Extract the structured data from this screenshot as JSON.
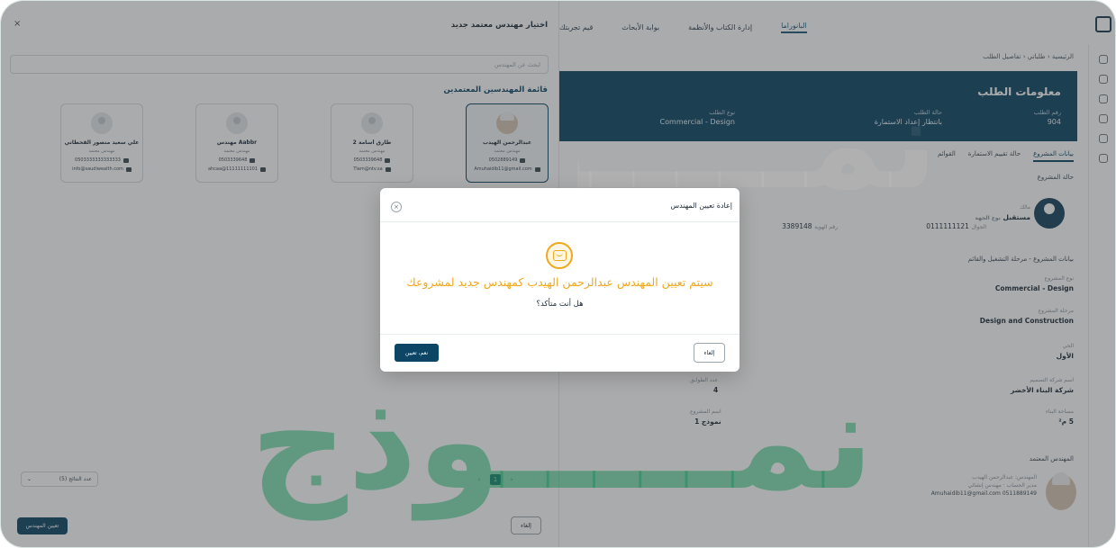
{
  "app": {
    "topnav": [
      "البانوراما",
      "إدارة الكتاب والأنظمة",
      "بوابة الأبحاث",
      "قيم تجربتك"
    ],
    "breadcrumb": "الرئيسية ‹ طلباتي ‹ تفاصيل الطلب",
    "banner": {
      "title": "معلومات الطلب",
      "cells": [
        {
          "label": "رقم الطلب",
          "value": "904"
        },
        {
          "label": "حالة الطلب",
          "value": "بانتظار إعداد الاستمارة"
        },
        {
          "label": "نوع الطلب",
          "value": "Commercial - Design"
        }
      ]
    },
    "tabs": [
      "بيانات المشروع",
      "حالة تقييم الاستمارة",
      "القوائم"
    ],
    "project_section": "حالة المشروع",
    "owner": {
      "name": "مالك",
      "type_label": "نوع الجهة",
      "type_value": "مستقبل",
      "phone_label": "الجوال",
      "phone": "0111111121",
      "id_label": "رقم الهوية",
      "id_value": "3389148"
    },
    "project_data_title": "بيانات المشروع - مرحلة التشغيل والقائم",
    "fields": [
      {
        "label": "نوع المشروع",
        "value": "Commercial - Design"
      },
      {
        "label": "مرحلة المشروع",
        "value": "Design and Construction"
      },
      {
        "label": "الحي",
        "value": "الأول"
      },
      {
        "label": "اسم شركة التصميم",
        "value": "شركة البناء الأخضر"
      },
      {
        "label": "مساحة البناء",
        "value": "5 م²"
      }
    ],
    "left_fields": [
      {
        "label": "عدد الطوابق",
        "value": "4"
      },
      {
        "label": "اسم المشروع",
        "value": "نموذج 1"
      }
    ],
    "engineer_section": "المهندس المعتمد",
    "engineer": {
      "title": "المهندس: عبدالرحمن الهيدب",
      "role": "مدير الحساب",
      "extra": "مهندس إنشائي",
      "email": "Amuhaidib11@gmail.com",
      "phone": "0511889149"
    }
  },
  "drawer": {
    "title": "اختيار مهندس معتمد جديد",
    "search_placeholder": "ابحث عن المهندس",
    "list_title": "قائمة المهندسين المعتمدين",
    "engineers": [
      {
        "name": "عبدالرحمن الهيدب",
        "role": "مهندس معتمد",
        "phone": "0502889149",
        "email": "Amuhaidib11@gmail.com",
        "has_photo": true,
        "selected": true
      },
      {
        "name": "طارق أسامة 2",
        "role": "مهندس معتمد",
        "phone": "0503339648",
        "email": "Tlam@ntv.sa",
        "has_photo": false,
        "selected": false
      },
      {
        "name": "مهندس Aabbr",
        "role": "مهندس معتمد",
        "phone": "0503339648",
        "email": "ahcaa@11111111101",
        "has_photo": false,
        "selected": false
      },
      {
        "name": "علي سعيد منصور القحطاني",
        "role": "مهندس معتمد",
        "phone": "0503333333333333",
        "email": "info@saudiwealth.com",
        "has_photo": false,
        "selected": false
      }
    ],
    "pager": {
      "prev": "‹",
      "current": "1",
      "next": "›"
    },
    "page_size_label": "عدد النتائج (5)",
    "page_size_arrow": "⌄",
    "assign_button": "تعيين المهندس",
    "cancel_button": "إلغاء"
  },
  "modal": {
    "title": "إعادة تعيين المهندس",
    "close": "×",
    "message": "سيتم تعيين المهندس عبدالرحمن الهيدب كمهندس جديد لمشروعك",
    "question": "هل أنت متأكد؟",
    "confirm_button": "نعم، تعيين",
    "cancel_button": "إلغاء"
  },
  "watermark": "نمـــــوذج",
  "colors": {
    "brand": "#0d4665",
    "warning": "#f0a81a",
    "watermark": "#228b5c"
  }
}
